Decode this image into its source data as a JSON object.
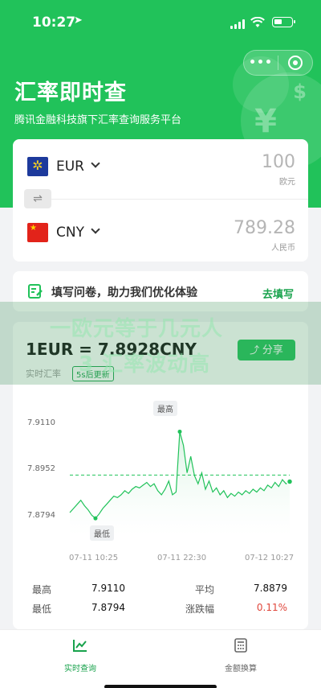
{
  "status_bar": {
    "time": "10:27",
    "location_arrow": "location-arrow-icon"
  },
  "capsule": {
    "more_label": "•••"
  },
  "hero": {
    "title": "汇率即时查",
    "subtitle": "腾讯金融科技旗下汇率查询服务平台"
  },
  "converter": {
    "from": {
      "code": "EUR",
      "amount": "100",
      "unit": "欧元",
      "flag": "eu-flag-icon"
    },
    "to": {
      "code": "CNY",
      "amount": "789.28",
      "unit": "人民币",
      "flag": "cn-flag-icon"
    },
    "swap_icon": "⇌"
  },
  "survey": {
    "text": "填写问卷，助力我们优化体验",
    "link": "去填写"
  },
  "overlay": {
    "line1": "一欧元等于几元人",
    "line2": "3 汇率波动高"
  },
  "rate": {
    "title": "1EUR = 7.8928CNY",
    "realtime_label": "实时汇率",
    "badge": "5s后更新",
    "share_label": "分享"
  },
  "chart_data": {
    "type": "area",
    "title": "",
    "xlabel": "",
    "ylabel": "",
    "x_ticks": [
      "07-11 10:25",
      "07-11 22:30",
      "07-12 10:27"
    ],
    "y_ticks": [
      "7.9110",
      "7.8952",
      "7.8794"
    ],
    "ylim": [
      7.873,
      7.917
    ],
    "reference_line": 7.8952,
    "series": [
      {
        "values": [
          7.8815,
          7.883,
          7.8845,
          7.886,
          7.884,
          7.8825,
          7.8805,
          7.8794,
          7.881,
          7.883,
          7.8845,
          7.886,
          7.8875,
          7.887,
          7.888,
          7.8895,
          7.8885,
          7.89,
          7.891,
          7.8905,
          7.8915,
          7.8925,
          7.891,
          7.892,
          7.8895,
          7.888,
          7.89,
          7.893,
          7.888,
          7.889,
          7.911,
          7.906,
          7.896,
          7.902,
          7.895,
          7.892,
          7.896,
          7.89,
          7.893,
          7.889,
          7.8905,
          7.888,
          7.8895,
          7.887,
          7.8885,
          7.8875,
          7.889,
          7.888,
          7.8895,
          7.8885,
          7.89,
          7.889,
          7.8905,
          7.8895,
          7.8915,
          7.8905,
          7.8925,
          7.891,
          7.8935,
          7.892,
          7.8928
        ]
      }
    ],
    "high_label": "最高",
    "low_label": "最低",
    "colors": {
      "line": "#21c25a",
      "fill": "#d7f3e1",
      "ref": "#21c25a"
    }
  },
  "stats": {
    "high_label": "最高",
    "high_value": "7.9110",
    "avg_label": "平均",
    "avg_value": "7.8879",
    "low_label": "最低",
    "low_value": "7.8794",
    "change_label": "涨跌幅",
    "change_value": "0.11%"
  },
  "tabbar": {
    "tabs": [
      {
        "label": "实时查询",
        "icon": "chart-line-icon"
      },
      {
        "label": "金额换算",
        "icon": "calculator-icon"
      }
    ]
  }
}
